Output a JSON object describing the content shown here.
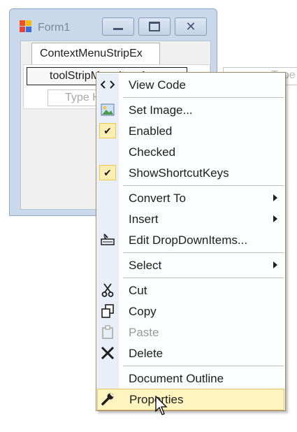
{
  "window": {
    "title": "Form1",
    "minimize_icon": "minimize-icon",
    "maximize_icon": "maximize-icon",
    "close_icon": "close-icon"
  },
  "designer": {
    "tab_label": "ContextMenuStripEx",
    "menu_item_text": "toolStripMenuItem1",
    "type_here_left": "Type Here",
    "type_here_right": "Type Here"
  },
  "context_menu": {
    "items": [
      {
        "label": "View Code",
        "icon": "code-icon"
      },
      {
        "label": "Set Image...",
        "icon": "image-icon"
      },
      {
        "label": "Enabled",
        "checked": true
      },
      {
        "label": "Checked",
        "checked": false
      },
      {
        "label": "ShowShortcutKeys",
        "checked": true
      },
      {
        "label": "Convert To",
        "submenu": true
      },
      {
        "label": "Insert",
        "submenu": true
      },
      {
        "label": "Edit DropDownItems...",
        "icon": "edit-items-icon"
      },
      {
        "label": "Select",
        "submenu": true
      },
      {
        "label": "Cut",
        "icon": "scissors-icon"
      },
      {
        "label": "Copy",
        "icon": "copy-icon"
      },
      {
        "label": "Paste",
        "icon": "paste-icon",
        "disabled": true
      },
      {
        "label": "Delete",
        "icon": "delete-icon"
      },
      {
        "label": "Document Outline"
      },
      {
        "label": "Properties",
        "icon": "wrench-icon",
        "highlighted": true
      }
    ]
  },
  "colors": {
    "menu_highlight": "#fdf4bf",
    "check_background": "#fdefb4",
    "window_frame": "#c9d8ea"
  }
}
